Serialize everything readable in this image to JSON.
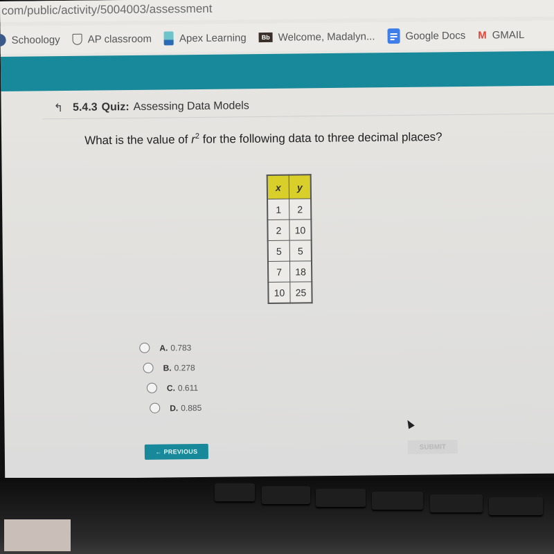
{
  "browser": {
    "url": "com/public/activity/5004003/assessment",
    "bookmarks": [
      {
        "label": "Schoology",
        "icon": "schoology-icon"
      },
      {
        "label": "AP classroom",
        "icon": "ap-classroom-icon"
      },
      {
        "label": "Apex Learning",
        "icon": "apex-learning-icon"
      },
      {
        "label": "Welcome, Madalyn...",
        "icon": "blackboard-icon",
        "icon_text": "Bb"
      },
      {
        "label": "Google Docs",
        "icon": "google-docs-icon"
      },
      {
        "label": "GMAIL",
        "icon": "gmail-icon",
        "icon_text": "M"
      }
    ]
  },
  "colors": {
    "accent": "#17899a",
    "table_header": "#d8cf2a"
  },
  "quiz": {
    "up_icon": "↰",
    "section": "5.4.3",
    "type": "Quiz:",
    "title": "Assessing Data Models",
    "question_pre": "What is the value of ",
    "question_var": "r",
    "question_sup": "2",
    "question_post": " for the following data to three decimal places?",
    "table": {
      "headers": [
        "x",
        "y"
      ],
      "rows": [
        [
          "1",
          "2"
        ],
        [
          "2",
          "10"
        ],
        [
          "5",
          "5"
        ],
        [
          "7",
          "18"
        ],
        [
          "10",
          "25"
        ]
      ]
    },
    "options": [
      {
        "letter": "A.",
        "value": "0.783"
      },
      {
        "letter": "B.",
        "value": "0.278"
      },
      {
        "letter": "C.",
        "value": "0.611"
      },
      {
        "letter": "D.",
        "value": "0.885"
      }
    ],
    "previous_label": "← PREVIOUS",
    "submit_label": "SUBMIT"
  }
}
